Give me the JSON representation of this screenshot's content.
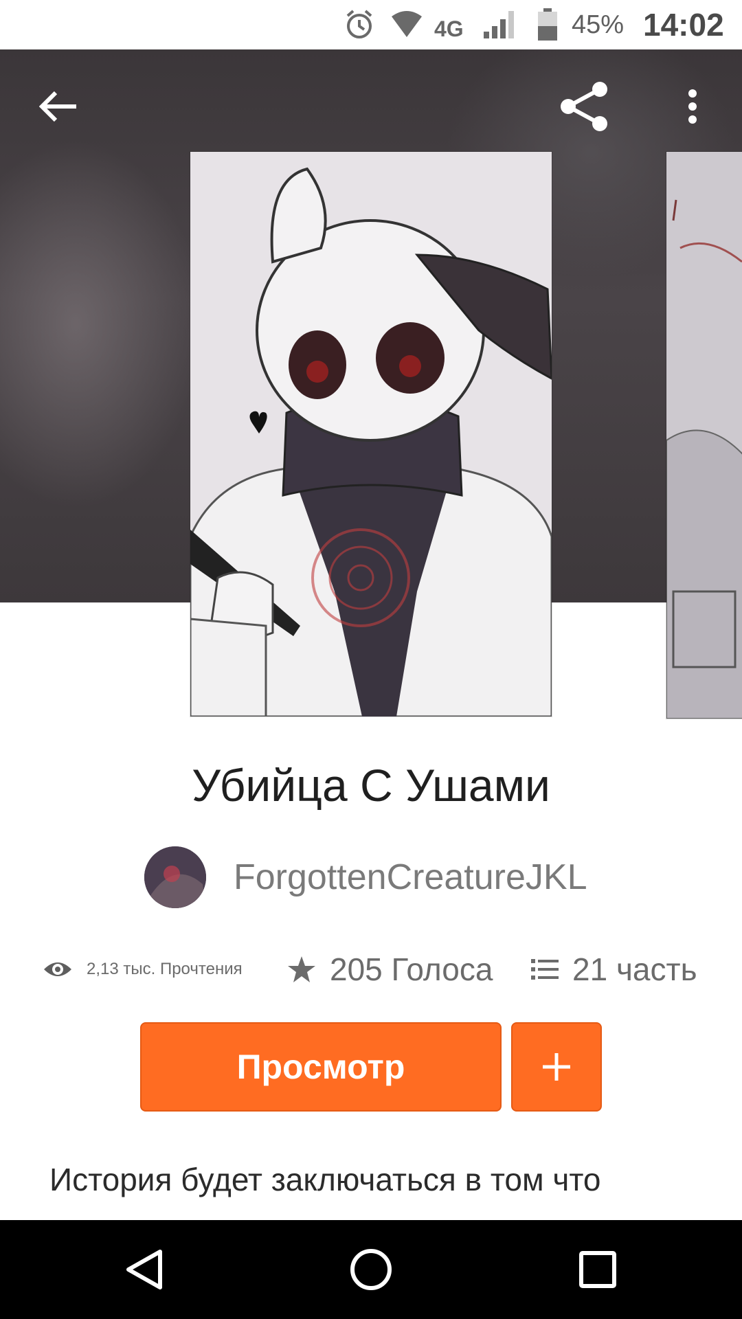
{
  "status_bar": {
    "network": "4G",
    "battery_percent": "45%",
    "time": "14:02",
    "icons": [
      "alarm-icon",
      "wifi-icon",
      "signal-icon",
      "battery-icon"
    ]
  },
  "toolbar": {
    "icons": [
      "back-arrow-icon",
      "share-icon",
      "more-vert-icon"
    ]
  },
  "story": {
    "title": "Убийца С Ушами",
    "author": "ForgottenCreatureJKL",
    "stats": {
      "reads": "2,13 тыс. Прочтения",
      "votes": "205 Голоса",
      "parts": "21 часть"
    },
    "read_button": "Просмотр",
    "add_button": "+",
    "description": "История будет заключаться в том что"
  },
  "colors": {
    "accent": "#ff6c22",
    "header_bg": "#413b3e"
  },
  "nav_bar": {
    "icons": [
      "back-triangle-icon",
      "home-circle-icon",
      "recents-square-icon"
    ]
  }
}
